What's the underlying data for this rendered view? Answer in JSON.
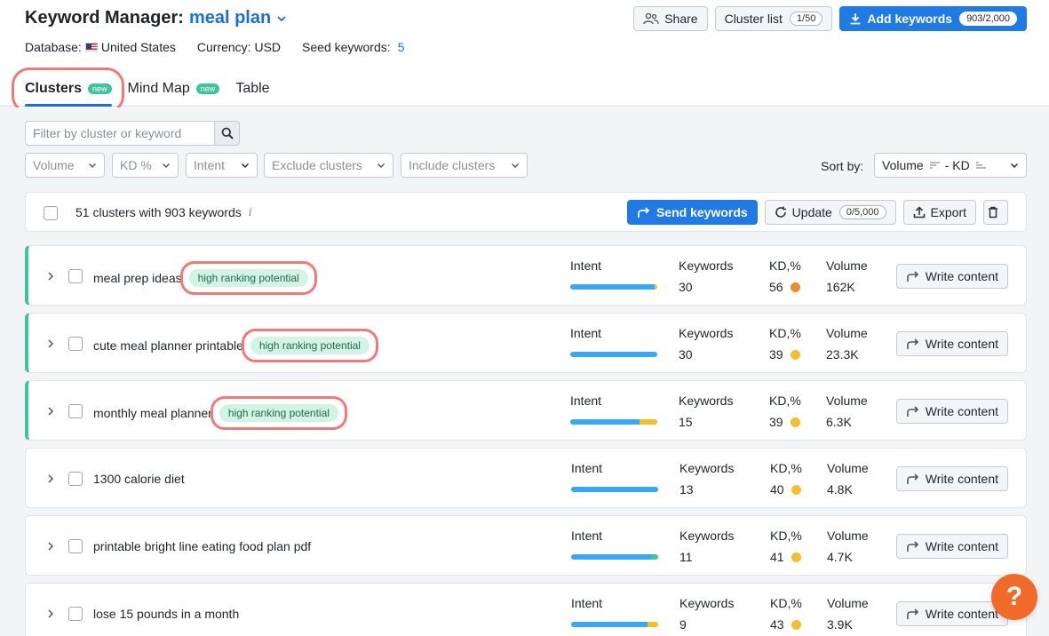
{
  "header": {
    "title": "Keyword Manager:",
    "project": "meal plan",
    "database_label": "Database:",
    "database_value": "United States",
    "currency": "Currency: USD",
    "seed_label": "Seed keywords:",
    "seed_count": "5",
    "share_label": "Share",
    "cluster_list_label": "Cluster list",
    "cluster_list_count": "1/50",
    "add_keywords_label": "Add keywords",
    "add_keywords_count": "903/2,000"
  },
  "tabs": [
    {
      "label": "Clusters",
      "badge": "new",
      "active": true
    },
    {
      "label": "Mind Map",
      "badge": "new",
      "active": false
    },
    {
      "label": "Table",
      "badge": "",
      "active": false
    }
  ],
  "filters": {
    "search_placeholder": "Filter by cluster or keyword",
    "volume": "Volume",
    "kd": "KD %",
    "intent": "Intent",
    "exclude": "Exclude clusters",
    "include": "Include clusters",
    "sort_label": "Sort by:",
    "sort_value": "Volume",
    "sort_sep": "- KD"
  },
  "summary": {
    "text": "51 clusters with 903 keywords",
    "info": "i",
    "send_label": "Send keywords",
    "update_label": "Update",
    "update_count": "0/5,000",
    "export_label": "Export"
  },
  "columns": {
    "intent": "Intent",
    "keywords": "Keywords",
    "kd": "KD,%",
    "volume": "Volume",
    "write": "Write content"
  },
  "colors": {
    "accent": "#1a6fd6",
    "primary_button": "#1f7ae6",
    "highlight": "#3fc49a",
    "annotation": "#ef7a7a",
    "kd_orange": "#ef8a2e",
    "kd_yellow": "#f4bf2e",
    "intent_blue": "#3aa8f0",
    "intent_yellow": "#f4bf2e",
    "intent_green": "#3fc49a"
  },
  "rows": [
    {
      "name": "meal prep ideas",
      "tag": "high ranking potential",
      "keywords": "30",
      "kd": "56",
      "kd_color": "#ef8a2e",
      "volume": "162K",
      "intent": [
        {
          "share": 0.97,
          "color": "#3aa8f0"
        },
        {
          "share": 0.03,
          "color": "#f4bf2e"
        }
      ]
    },
    {
      "name": "cute meal planner printable",
      "tag": "high ranking potential",
      "keywords": "30",
      "kd": "39",
      "kd_color": "#f4bf2e",
      "volume": "23.3K",
      "intent": [
        {
          "share": 1.0,
          "color": "#3aa8f0"
        }
      ]
    },
    {
      "name": "monthly meal planner",
      "tag": "high ranking potential",
      "keywords": "15",
      "kd": "39",
      "kd_color": "#f4bf2e",
      "volume": "6.3K",
      "intent": [
        {
          "share": 0.8,
          "color": "#3aa8f0"
        },
        {
          "share": 0.2,
          "color": "#f4bf2e"
        }
      ]
    },
    {
      "name": "1300 calorie diet",
      "tag": "",
      "keywords": "13",
      "kd": "40",
      "kd_color": "#f4bf2e",
      "volume": "4.8K",
      "intent": [
        {
          "share": 1.0,
          "color": "#3aa8f0"
        }
      ]
    },
    {
      "name": "printable bright line eating food plan pdf",
      "tag": "",
      "keywords": "11",
      "kd": "41",
      "kd_color": "#f4bf2e",
      "volume": "4.7K",
      "intent": [
        {
          "share": 0.92,
          "color": "#3aa8f0"
        },
        {
          "share": 0.08,
          "color": "#3fc49a"
        }
      ]
    },
    {
      "name": "lose 15 pounds in a month",
      "tag": "",
      "keywords": "9",
      "kd": "43",
      "kd_color": "#f4bf2e",
      "volume": "3.9K",
      "intent": [
        {
          "share": 0.88,
          "color": "#3aa8f0"
        },
        {
          "share": 0.12,
          "color": "#f4bf2e"
        }
      ]
    }
  ],
  "help_label": "?"
}
